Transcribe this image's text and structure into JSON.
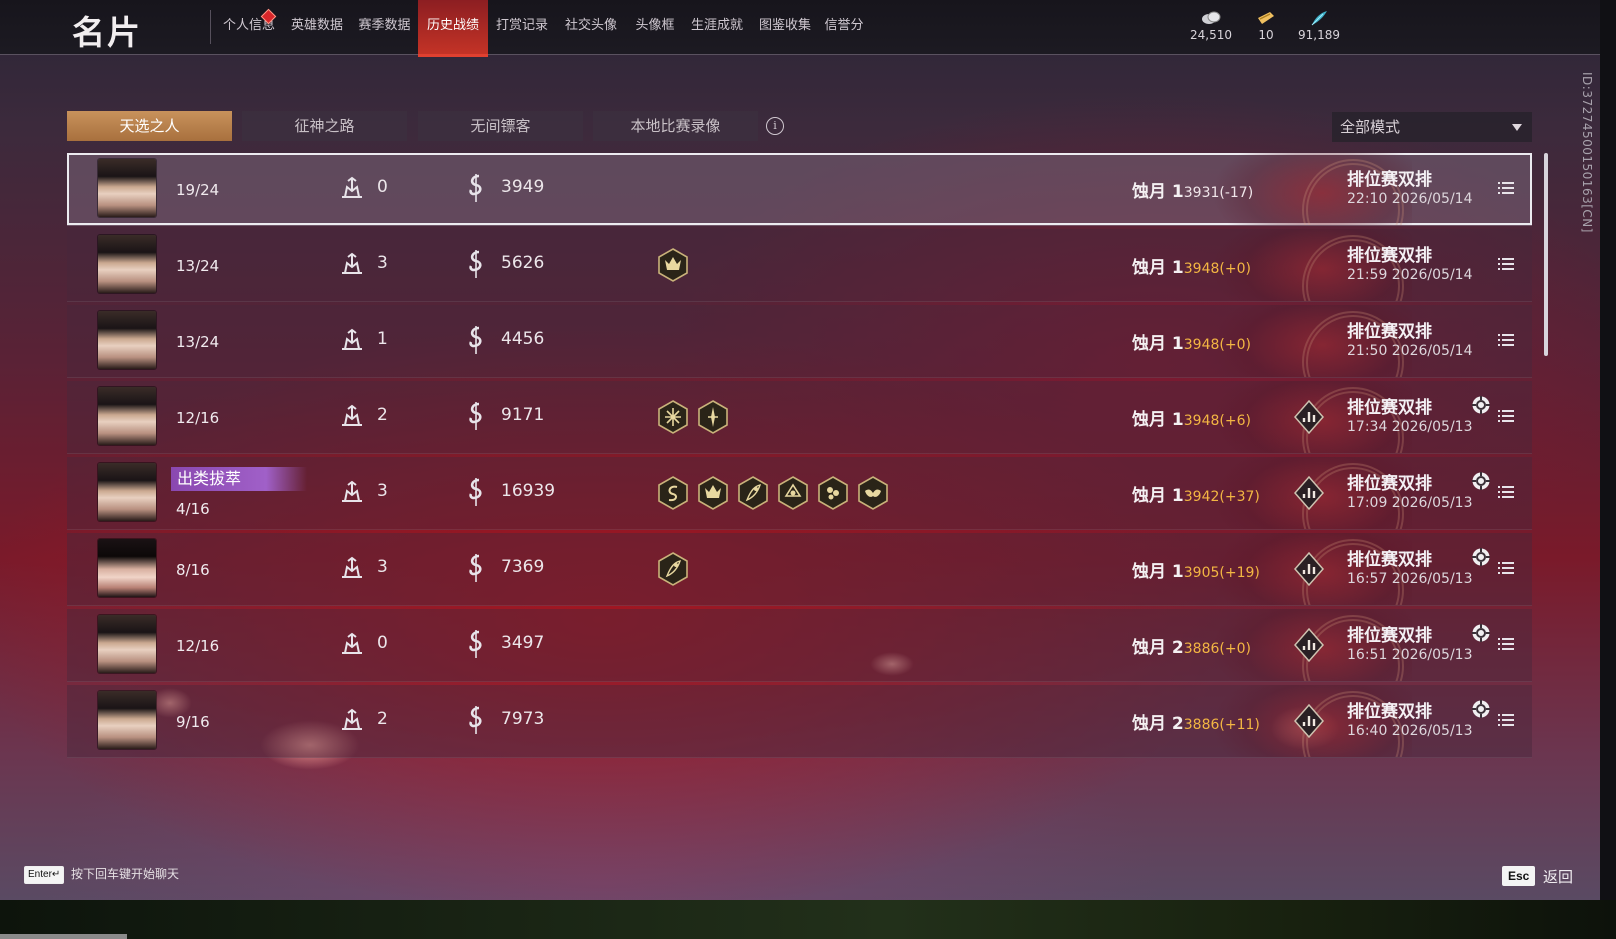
{
  "header": {
    "title": "名片",
    "tabs": [
      "个人信息",
      "英雄数据",
      "赛季数据",
      "历史战绩",
      "打赏记录",
      "社交头像",
      "头像框",
      "生涯成就",
      "图鉴收集",
      "信誉分"
    ],
    "active_tab": "历史战绩",
    "currencies": [
      {
        "icon": "coin-stack-icon",
        "value": "24,510"
      },
      {
        "icon": "ticket-icon",
        "value": "10"
      },
      {
        "icon": "feather-icon",
        "value": "91,189"
      }
    ]
  },
  "filters": {
    "tabs": [
      "天选之人",
      "征神之路",
      "无间镖客",
      "本地比赛录像"
    ],
    "active": "天选之人",
    "info_glyph": "i",
    "mode_select": "全部模式"
  },
  "matches": [
    {
      "avatar": "male",
      "rank": "19/24",
      "badge": "",
      "kills": "0",
      "damage": "3949",
      "hexes": [],
      "tier": "蚀月 1",
      "score": "3931(-17)",
      "score_gold": false,
      "has_stats": false,
      "has_chip": false,
      "type": "排位赛双排",
      "time": "22:10  2026/05/14",
      "selected": true
    },
    {
      "avatar": "male",
      "rank": "13/24",
      "badge": "",
      "kills": "3",
      "damage": "5626",
      "hexes": [
        "crown"
      ],
      "tier": "蚀月 1",
      "score": "3948(+0)",
      "score_gold": true,
      "has_stats": false,
      "has_chip": false,
      "type": "排位赛双排",
      "time": "21:59  2026/05/14",
      "selected": false
    },
    {
      "avatar": "male",
      "rank": "13/24",
      "badge": "",
      "kills": "1",
      "damage": "4456",
      "hexes": [],
      "tier": "蚀月 1",
      "score": "3948(+0)",
      "score_gold": true,
      "has_stats": false,
      "has_chip": false,
      "type": "排位赛双排",
      "time": "21:50  2026/05/14",
      "selected": false
    },
    {
      "avatar": "male",
      "rank": "12/16",
      "badge": "",
      "kills": "2",
      "damage": "9171",
      "hexes": [
        "star",
        "blade"
      ],
      "tier": "蚀月 1",
      "score": "3948(+6)",
      "score_gold": true,
      "has_stats": true,
      "has_chip": true,
      "type": "排位赛双排",
      "time": "17:34  2026/05/13",
      "selected": false
    },
    {
      "avatar": "male",
      "rank": "4/16",
      "badge": "出类拔萃",
      "kills": "3",
      "damage": "16939",
      "hexes": [
        "swirl",
        "crown",
        "slash",
        "helm",
        "cluster",
        "wings"
      ],
      "tier": "蚀月 1",
      "score": "3942(+37)",
      "score_gold": true,
      "has_stats": true,
      "has_chip": true,
      "type": "排位赛双排",
      "time": "17:09  2026/05/13",
      "selected": false
    },
    {
      "avatar": "female",
      "rank": "8/16",
      "badge": "",
      "kills": "3",
      "damage": "7369",
      "hexes": [
        "slash"
      ],
      "tier": "蚀月 1",
      "score": "3905(+19)",
      "score_gold": true,
      "has_stats": true,
      "has_chip": true,
      "type": "排位赛双排",
      "time": "16:57  2026/05/13",
      "selected": false
    },
    {
      "avatar": "male",
      "rank": "12/16",
      "badge": "",
      "kills": "0",
      "damage": "3497",
      "hexes": [],
      "tier": "蚀月 2",
      "score": "3886(+0)",
      "score_gold": true,
      "has_stats": true,
      "has_chip": true,
      "type": "排位赛双排",
      "time": "16:51  2026/05/13",
      "selected": false
    },
    {
      "avatar": "male",
      "rank": "9/16",
      "badge": "",
      "kills": "2",
      "damage": "7973",
      "hexes": [],
      "tier": "蚀月 2",
      "score": "3886(+11)",
      "score_gold": true,
      "has_stats": true,
      "has_chip": true,
      "type": "排位赛双排",
      "time": "16:40  2026/05/13",
      "selected": false
    }
  ],
  "player_id": "ID:3727450015016​3[CN]",
  "footer": {
    "enter_key": "Enter↵",
    "chat_hint": "按下回车键开始聊天",
    "esc_key": "Esc",
    "back_label": "返回"
  },
  "colors": {
    "accent": "#c43326",
    "gold_score": "#f3b643",
    "active_filter": "#b87c48",
    "badge_purple": "#9a58c0"
  }
}
